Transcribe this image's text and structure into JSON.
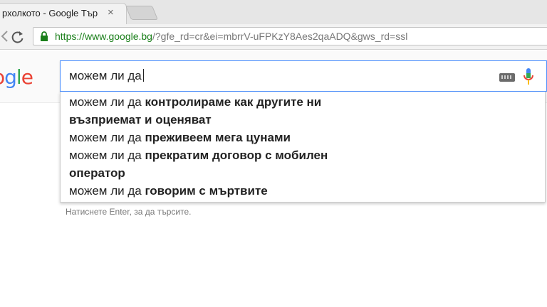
{
  "browser": {
    "tab_title": "рхолкото - Google Тър",
    "tab_close": "×",
    "url_host": "https://www.google.bg",
    "url_rest": "/?gfe_rd=cr&ei=mbrrV-uFPKzY8Aes2qaADQ&gws_rd=ssl"
  },
  "search": {
    "query": "можем ли да",
    "logo": [
      "o",
      "g",
      "l",
      "e"
    ],
    "logo_colors": [
      "#ea4335",
      "#4285f4",
      "#34a853",
      "#ea4335"
    ]
  },
  "suggestions": [
    {
      "prefix": "можем ли да ",
      "completion": "контролираме как другите ни"
    },
    {
      "prefix": "",
      "completion": "възприемат и оценяват"
    },
    {
      "prefix": "можем ли да ",
      "completion": "преживеем мега цунами"
    },
    {
      "prefix": "можем ли да ",
      "completion": "прекратим договор с мобилен"
    },
    {
      "prefix": "",
      "completion": "оператор"
    },
    {
      "prefix": "можем ли да ",
      "completion": "говорим с мъртвите"
    }
  ],
  "hint": "Натиснете Enter, за да търсите.",
  "colors": {
    "focus_border": "#4d90fe",
    "secure_green": "#1a7f1a"
  }
}
